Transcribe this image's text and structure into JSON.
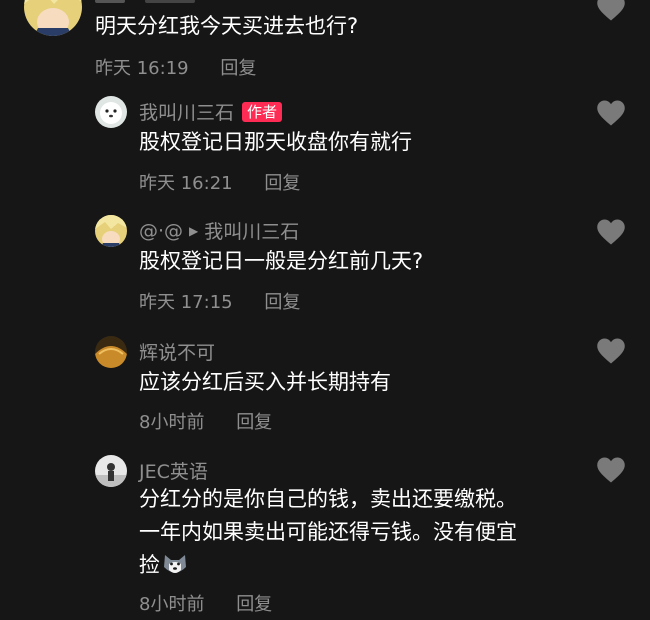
{
  "colors": {
    "background": "#161616",
    "text": "#ffffff",
    "secondary": "#8f8f8f",
    "author_badge": "#fe2c55",
    "like_icon": "#7a7a7a"
  },
  "comments": [
    {
      "author": "",
      "text": "明天分红我今天买进去也行?",
      "time": "昨天 16:19",
      "reply": "回复"
    },
    {
      "author": "我叫川三石",
      "badge": "作者",
      "text": "股权登记日那天收盘你有就行",
      "time": "昨天 16:21",
      "reply": "回复"
    },
    {
      "author": "@·@",
      "reply_to": "我叫川三石",
      "text": "股权登记日一般是分红前几天?",
      "time": "昨天 17:15",
      "reply": "回复"
    },
    {
      "author": "辉说不可",
      "text": "应该分红后买入并长期持有",
      "time": "8小时前",
      "reply": "回复"
    },
    {
      "author": "JEC英语",
      "text_lines": [
        "分红分的是你自己的钱，卖出还要缴税。",
        "一年内如果卖出可能还得亏钱。没有便宜",
        "捡"
      ],
      "emoji": "husky-emoji",
      "time": "8小时前",
      "reply": "回复"
    }
  ],
  "icons": {
    "like": "heart-icon",
    "reply_arrow": "play-arrow-icon"
  }
}
